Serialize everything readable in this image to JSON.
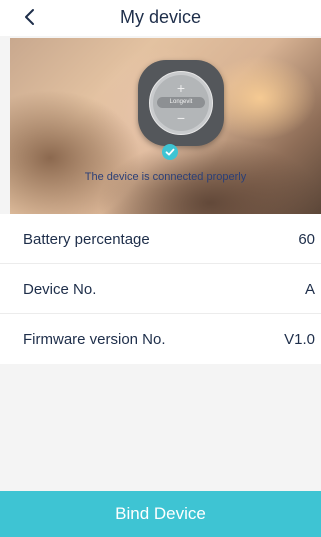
{
  "header": {
    "title": "My device",
    "back_icon": "chevron-left-icon"
  },
  "hero": {
    "device_plus": "+",
    "device_minus": "−",
    "device_logo": "Longevit",
    "status_icon": "check-circle-icon",
    "status_text": "The device is connected properly"
  },
  "info": {
    "rows": [
      {
        "label": "Battery percentage",
        "value": "60"
      },
      {
        "label": "Device No.",
        "value": "A"
      },
      {
        "label": "Firmware version No.",
        "value": "V1.0"
      }
    ]
  },
  "footer": {
    "bind_label": "Bind Device"
  },
  "colors": {
    "accent": "#3ec4d3",
    "text": "#1e2e4a",
    "status_text": "#2a3f78"
  }
}
